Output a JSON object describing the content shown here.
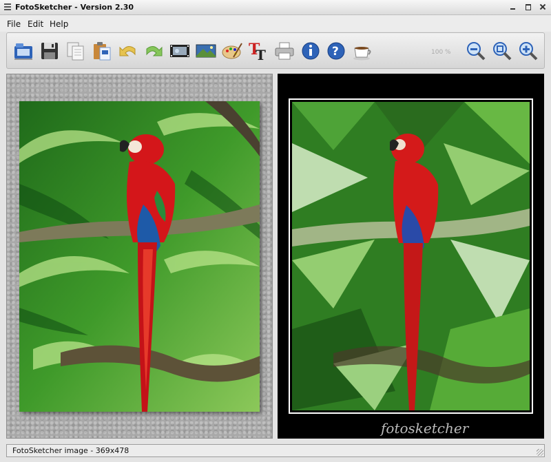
{
  "window": {
    "title": "FotoSketcher - Version 2.30"
  },
  "menu": {
    "file": "File",
    "edit": "Edit",
    "help": "Help"
  },
  "toolbar": {
    "buttons": [
      "open-icon",
      "save-icon",
      "copy-icon",
      "paste-icon",
      "undo-icon",
      "redo-icon",
      "film-strip-icon",
      "landscape-icon",
      "palette-icon",
      "text-icon",
      "print-icon",
      "info-icon",
      "help-icon",
      "coffee-icon",
      "zoom-out-icon",
      "zoom-actual-icon",
      "zoom-in-icon"
    ],
    "zoom_label": "100 %"
  },
  "signature": "fotosketcher",
  "status": {
    "text": "FotoSketcher image - 369x478"
  },
  "colors": {
    "accent_blue": "#1e5aa8",
    "parrot_red": "#d4161a",
    "foliage_green": "#3f9a2a"
  }
}
